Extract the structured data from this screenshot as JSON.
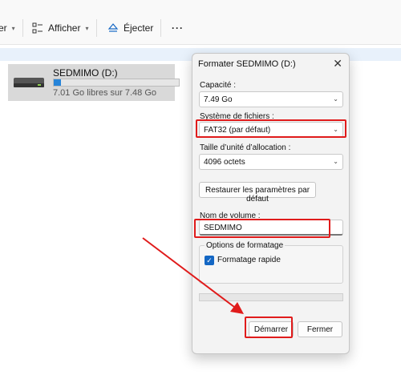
{
  "toolbar": {
    "partial_label": "er",
    "view_label": "Afficher",
    "eject_label": "Éjecter",
    "more_label": "···"
  },
  "drive": {
    "name": "SEDMIMO (D:)",
    "space_text": "7.01 Go libres sur 7.48 Go",
    "used_fraction": 0.06
  },
  "dialog": {
    "title": "Formater SEDMIMO (D:)",
    "close_glyph": "✕",
    "capacity_label": "Capacité :",
    "capacity_value": "7.49 Go",
    "filesystem_label": "Système de fichiers :",
    "filesystem_value": "FAT32 (par défaut)",
    "allocation_label": "Taille d’unité d’allocation :",
    "allocation_value": "4096 octets",
    "restore_label": "Restaurer les paramètres par défaut",
    "volume_label": "Nom de volume :",
    "volume_value": "SEDMIMO",
    "options_label": "Options de formatage",
    "quick_format_label": "Formatage rapide",
    "quick_format_checked": true,
    "start_label": "Démarrer",
    "close_label": "Fermer"
  },
  "colors": {
    "highlight": "#e01b1b",
    "accent": "#1467c4"
  }
}
